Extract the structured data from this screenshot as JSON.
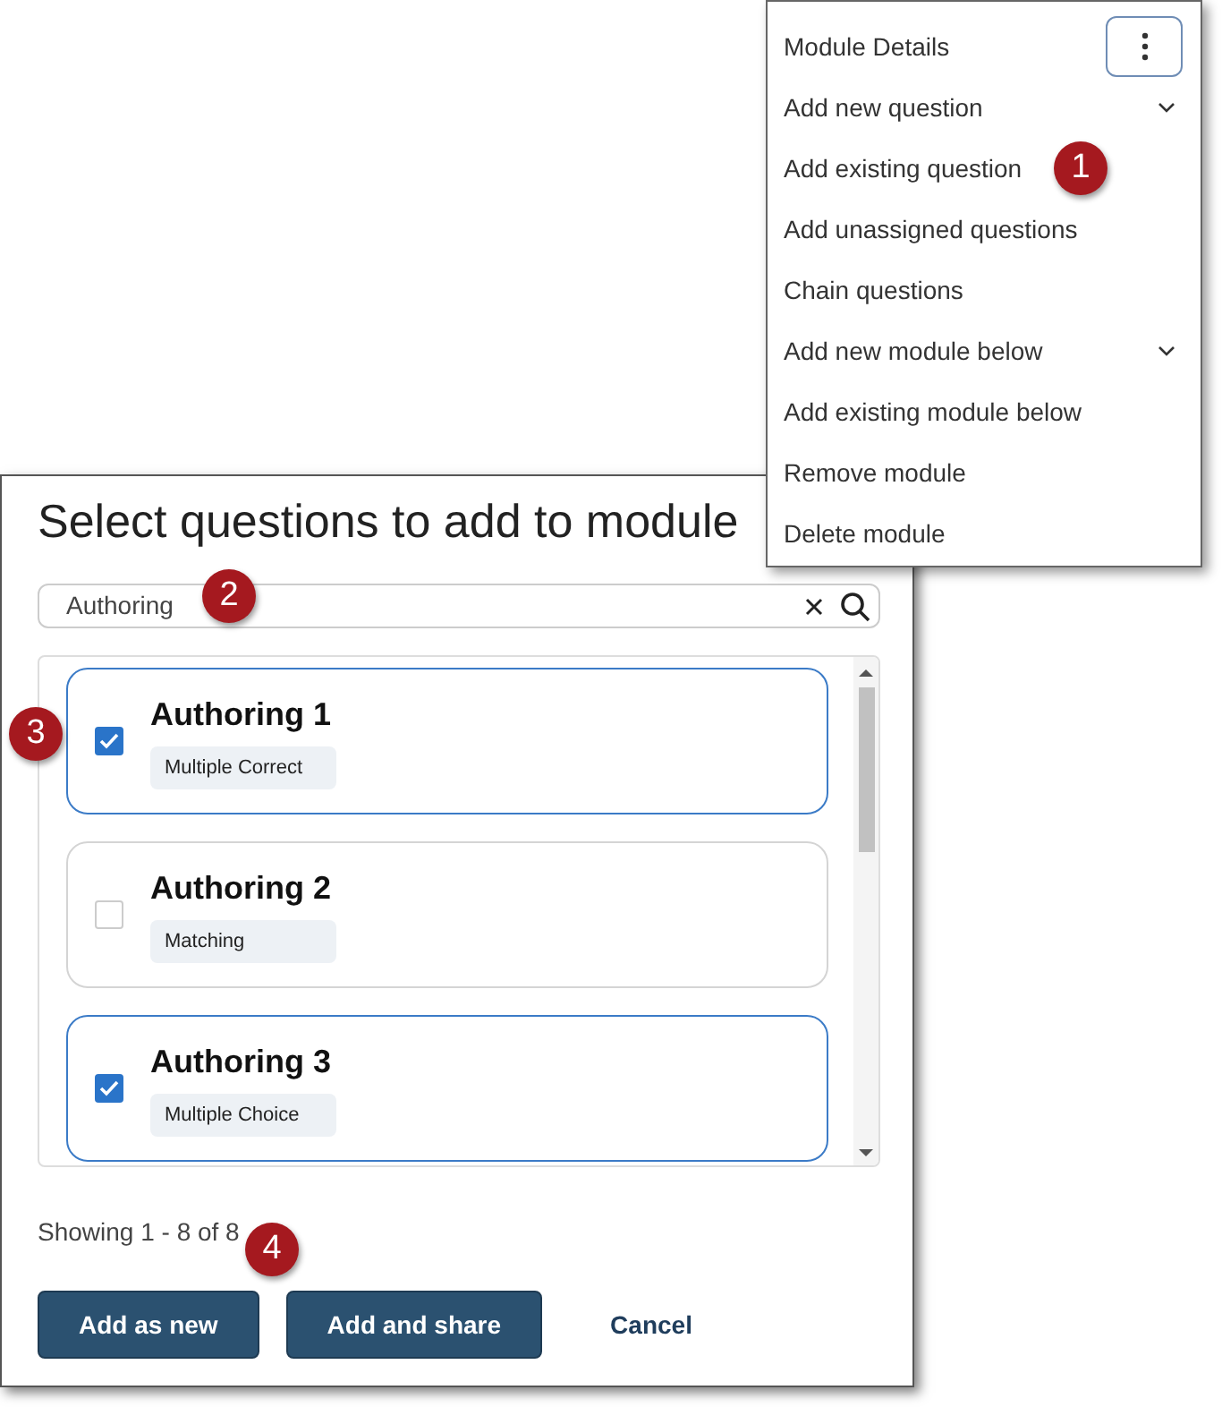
{
  "menu": {
    "items": [
      {
        "label": "Module Details",
        "kind": "more"
      },
      {
        "label": "Add new question",
        "kind": "expand"
      },
      {
        "label": "Add existing question",
        "kind": "plain"
      },
      {
        "label": "Add unassigned questions",
        "kind": "plain"
      },
      {
        "label": "Chain questions",
        "kind": "plain"
      },
      {
        "label": "Add new module below",
        "kind": "expand"
      },
      {
        "label": "Add existing module below",
        "kind": "plain"
      },
      {
        "label": "Remove module",
        "kind": "plain"
      },
      {
        "label": "Delete module",
        "kind": "plain"
      }
    ]
  },
  "dialog": {
    "title": "Select questions to add to module",
    "search": {
      "value": "Authoring"
    },
    "questions": [
      {
        "title": "Authoring 1",
        "tag": "Multiple Correct",
        "checked": true
      },
      {
        "title": "Authoring 2",
        "tag": "Matching",
        "checked": false
      },
      {
        "title": "Authoring 3",
        "tag": "Multiple Choice",
        "checked": true
      }
    ],
    "count": "Showing 1 - 8 of 8",
    "buttons": [
      {
        "label": "Add as new",
        "kind": "primary"
      },
      {
        "label": "Add and share",
        "kind": "primary"
      },
      {
        "label": "Cancel",
        "kind": "link"
      }
    ]
  },
  "callouts": [
    "1",
    "2",
    "3",
    "4"
  ]
}
